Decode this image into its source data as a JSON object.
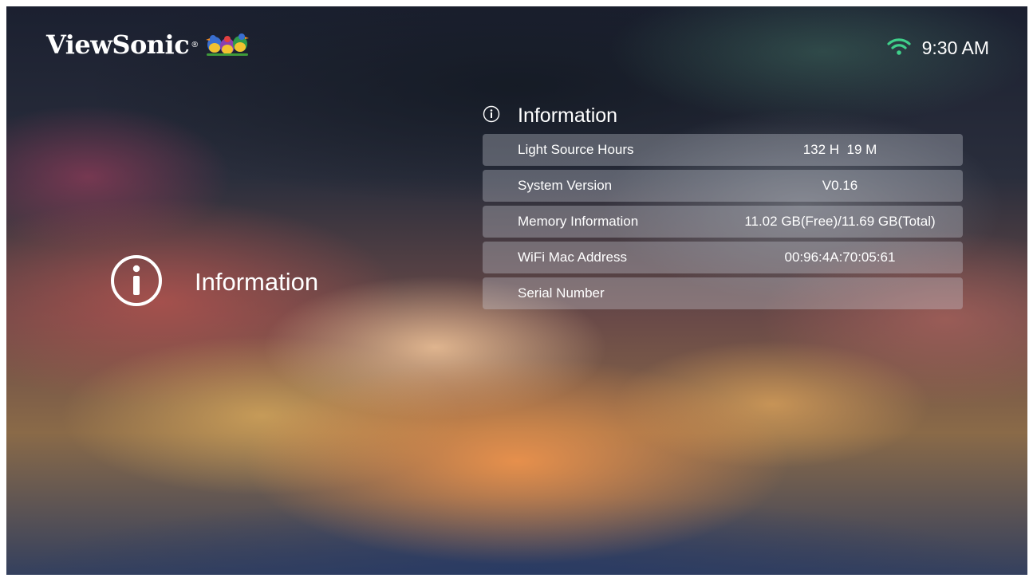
{
  "brand": {
    "name": "ViewSonic",
    "registered_mark": "®"
  },
  "status_bar": {
    "time": "9:30 AM",
    "wifi_color": "#3fd08a"
  },
  "left_section": {
    "icon": "info-circle-icon",
    "label": "Information"
  },
  "panel": {
    "title_icon": "info-circle-icon",
    "title": "Information",
    "rows": [
      {
        "label": "Light Source Hours",
        "value": "132 H  19 M"
      },
      {
        "label": "System Version",
        "value": "V0.16"
      },
      {
        "label": "Memory Information",
        "value": "11.02 GB(Free)/11.69 GB(Total)"
      },
      {
        "label": "WiFi Mac Address",
        "value": "00:96:4A:70:05:61"
      },
      {
        "label": "Serial Number",
        "value": ""
      }
    ]
  }
}
